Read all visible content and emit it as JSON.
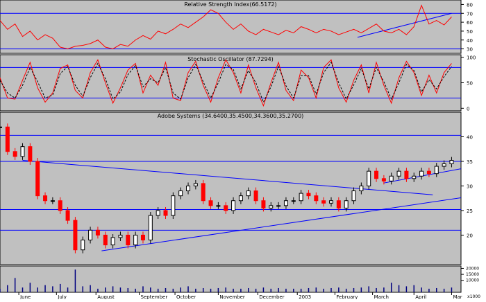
{
  "chart_data": [
    {
      "type": "line",
      "title": "Relative Strength Index(66.5172)",
      "ylim": [
        25,
        85
      ],
      "yticks": [
        30,
        40,
        50,
        60,
        70,
        80
      ],
      "reference_lines": [
        30,
        70
      ],
      "grid": false,
      "series": [
        {
          "color": "#ff0000",
          "x": [
            0,
            4,
            8,
            12,
            16,
            20,
            24,
            28,
            32,
            36,
            40,
            44,
            48,
            52,
            56,
            60,
            64,
            68,
            72,
            76,
            80,
            84,
            88,
            92,
            96,
            100,
            104,
            108,
            112,
            116,
            120,
            124,
            128,
            132,
            136,
            140,
            144,
            148,
            152,
            156,
            160,
            164,
            168,
            172,
            176,
            180,
            184,
            188,
            192,
            196,
            200,
            204,
            208,
            212,
            216,
            220,
            224,
            228,
            232,
            236,
            240
          ],
          "y": [
            62,
            52,
            58,
            44,
            50,
            40,
            46,
            42,
            32,
            30,
            33,
            34,
            36,
            40,
            32,
            30,
            35,
            33,
            40,
            45,
            41,
            50,
            47,
            52,
            58,
            54,
            60,
            66,
            74,
            70,
            60,
            52,
            58,
            50,
            46,
            52,
            49,
            46,
            51,
            48,
            55,
            52,
            48,
            52,
            50,
            46,
            49,
            52,
            48,
            53,
            58,
            50,
            48,
            52,
            46,
            55,
            79,
            58,
            62,
            57,
            66
          ]
        }
      ],
      "trendlines": [
        {
          "x": [
            190,
            240
          ],
          "y": [
            43,
            70
          ]
        }
      ]
    },
    {
      "type": "line",
      "title": "Stochastic Oscillator (87.7294)",
      "ylim": [
        -5,
        105
      ],
      "yticks": [
        0,
        50,
        100
      ],
      "reference_lines": [
        20,
        80
      ],
      "grid": false,
      "series": [
        {
          "name": "%K",
          "color": "#ff0000",
          "x": [
            0,
            4,
            8,
            12,
            16,
            20,
            24,
            28,
            32,
            36,
            40,
            44,
            48,
            52,
            56,
            60,
            64,
            68,
            72,
            76,
            80,
            84,
            88,
            92,
            96,
            100,
            104,
            108,
            112,
            116,
            120,
            124,
            128,
            132,
            136,
            140,
            144,
            148,
            152,
            156,
            160,
            164,
            168,
            172,
            176,
            180,
            184,
            188,
            192,
            196,
            200,
            204,
            208,
            212,
            216,
            220,
            224,
            228,
            232,
            236,
            240
          ],
          "y": [
            60,
            20,
            18,
            55,
            90,
            40,
            12,
            30,
            78,
            85,
            35,
            20,
            70,
            95,
            50,
            10,
            40,
            75,
            88,
            30,
            65,
            45,
            90,
            20,
            15,
            70,
            92,
            45,
            12,
            60,
            95,
            70,
            30,
            85,
            40,
            5,
            50,
            90,
            35,
            15,
            75,
            60,
            20,
            80,
            95,
            40,
            12,
            55,
            85,
            30,
            90,
            45,
            10,
            60,
            92,
            70,
            25,
            65,
            30,
            70,
            88
          ]
        },
        {
          "name": "%D",
          "color": "#000000",
          "dashed": true,
          "x": [
            0,
            4,
            8,
            12,
            16,
            20,
            24,
            28,
            32,
            36,
            40,
            44,
            48,
            52,
            56,
            60,
            64,
            68,
            72,
            76,
            80,
            84,
            88,
            92,
            96,
            100,
            104,
            108,
            112,
            116,
            120,
            124,
            128,
            132,
            136,
            140,
            144,
            148,
            152,
            156,
            160,
            164,
            168,
            172,
            176,
            180,
            184,
            188,
            192,
            196,
            200,
            204,
            208,
            212,
            216,
            220,
            224,
            228,
            232,
            236,
            240
          ],
          "y": [
            55,
            30,
            20,
            45,
            80,
            52,
            20,
            26,
            68,
            82,
            45,
            24,
            60,
            88,
            58,
            18,
            32,
            66,
            84,
            42,
            58,
            50,
            80,
            30,
            18,
            60,
            86,
            52,
            20,
            50,
            86,
            76,
            38,
            74,
            50,
            12,
            42,
            82,
            44,
            20,
            64,
            64,
            28,
            70,
            90,
            50,
            18,
            46,
            78,
            38,
            80,
            52,
            18,
            50,
            86,
            74,
            32,
            56,
            38,
            62,
            82
          ]
        }
      ]
    },
    {
      "type": "line",
      "title": "Adobe Systems (34.6400,35.4500,34.3600,35.2700)",
      "ylim": [
        14,
        45
      ],
      "yticks": [
        20,
        25,
        30,
        35,
        40
      ],
      "reference_lines": [
        21,
        25.2,
        35,
        40.3
      ],
      "grid": false,
      "series": [
        {
          "name": "close",
          "color": "#ff0000",
          "x": [
            0,
            4,
            8,
            12,
            16,
            20,
            24,
            28,
            32,
            36,
            40,
            44,
            48,
            52,
            56,
            60,
            64,
            68,
            72,
            76,
            80,
            84,
            88,
            92,
            96,
            100,
            104,
            108,
            112,
            116,
            120,
            124,
            128,
            132,
            136,
            140,
            144,
            148,
            152,
            156,
            160,
            164,
            168,
            172,
            176,
            180,
            184,
            188,
            192,
            196,
            200,
            204,
            208,
            212,
            216,
            220,
            224,
            228,
            232,
            236,
            240
          ],
          "y": [
            42,
            37,
            36,
            38,
            35,
            28,
            27,
            27,
            25,
            23,
            17,
            19,
            21,
            20,
            18,
            19.5,
            20,
            18,
            20,
            19,
            24,
            25,
            24,
            28,
            29,
            30,
            30.5,
            27,
            26,
            26,
            25,
            27,
            28,
            29,
            27,
            25.5,
            26,
            26,
            27,
            27,
            28.5,
            28,
            27,
            26.5,
            27,
            25.5,
            27,
            29,
            30,
            33,
            31.5,
            31,
            32,
            33,
            31.5,
            32,
            33,
            32.5,
            34,
            34.5,
            35.2
          ]
        }
      ],
      "trendlines": [
        {
          "x": [
            12,
            230
          ],
          "y": [
            35.2,
            28.2
          ]
        },
        {
          "x": [
            54,
            245
          ],
          "y": [
            16.8,
            27.6
          ]
        },
        {
          "x": [
            204,
            245
          ],
          "y": [
            30.6,
            33.5
          ]
        }
      ]
    },
    {
      "type": "bar",
      "title": "",
      "ylabel": "x1000",
      "yticks": [
        10000,
        15000,
        20000
      ],
      "series": [
        {
          "color": "#000080",
          "x": [
            0,
            4,
            8,
            12,
            16,
            20,
            24,
            28,
            32,
            36,
            40,
            44,
            48,
            52,
            56,
            60,
            64,
            68,
            72,
            76,
            80,
            84,
            88,
            92,
            96,
            100,
            104,
            108,
            112,
            116,
            120,
            124,
            128,
            132,
            136,
            140,
            144,
            148,
            152,
            156,
            160,
            164,
            168,
            172,
            176,
            180,
            184,
            188,
            192,
            196,
            200,
            204,
            208,
            212,
            216,
            220,
            224,
            228,
            232,
            236,
            240
          ],
          "y": [
            3000,
            6000,
            12000,
            4000,
            8000,
            4000,
            6000,
            5000,
            7000,
            4000,
            19000,
            5000,
            6000,
            3000,
            4000,
            5000,
            4000,
            3500,
            3000,
            5000,
            4000,
            3000,
            3500,
            3000,
            4000,
            5000,
            3000,
            3500,
            3000,
            3500,
            4000,
            3000,
            3000,
            3500,
            3000,
            4000,
            3000,
            3500,
            3000,
            3000,
            3000,
            3500,
            4000,
            3000,
            3500,
            4000,
            3000,
            3500,
            4000,
            5000,
            3500,
            4000,
            8000,
            6000,
            5000,
            6000,
            4000,
            3000,
            3500,
            3000,
            4000
          ]
        }
      ]
    }
  ],
  "x_axis": {
    "labels": [
      {
        "x": 10,
        "text": "June"
      },
      {
        "x": 30,
        "text": "July"
      },
      {
        "x": 51,
        "text": "August"
      },
      {
        "x": 74,
        "text": "September"
      },
      {
        "x": 93,
        "text": "October"
      },
      {
        "x": 116,
        "text": "November"
      },
      {
        "x": 137,
        "text": "December"
      },
      {
        "x": 158,
        "text": "2003"
      },
      {
        "x": 178,
        "text": "February"
      },
      {
        "x": 198,
        "text": "March"
      },
      {
        "x": 220,
        "text": "April"
      },
      {
        "x": 240,
        "text": "Mar"
      }
    ],
    "domain": [
      0,
      245
    ]
  },
  "colors": {
    "panel_bg": "#c0c0c0",
    "reference_line": "#0000ff",
    "up_candle": "#000000",
    "down_candle": "#ff0000",
    "volume": "#000080",
    "axis_text": "#000000"
  }
}
